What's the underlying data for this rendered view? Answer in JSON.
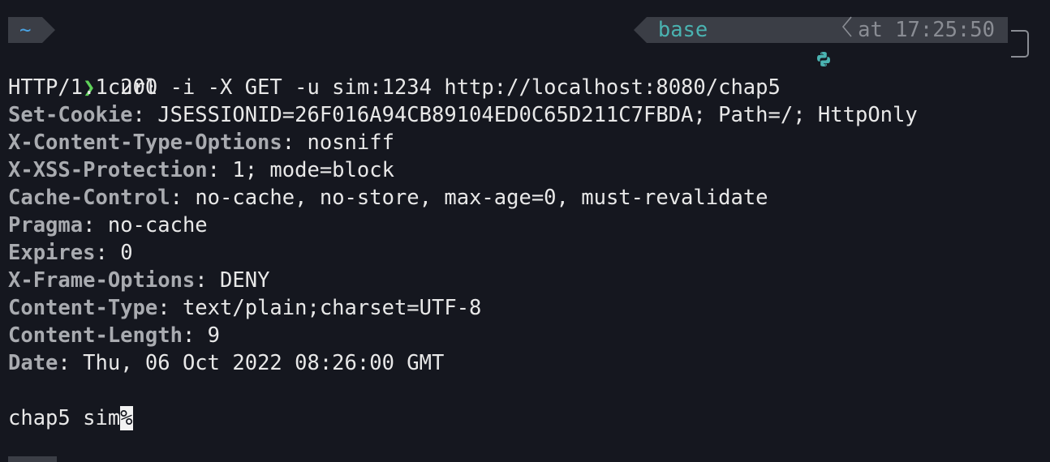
{
  "prompt": {
    "cwd": "~",
    "env_name": "base",
    "env_icon": "python-icon",
    "at_label": "at",
    "time": "17:25:50",
    "prompt_symbol": "❯"
  },
  "command": "curl -i -X GET -u sim:1234 http://localhost:8080/chap5",
  "status_line": "HTTP/1.1 200",
  "headers": [
    {
      "key": "Set-Cookie",
      "value": "JSESSIONID=26F016A94CB89104ED0C65D211C7FBDA; Path=/; HttpOnly"
    },
    {
      "key": "X-Content-Type-Options",
      "value": "nosniff"
    },
    {
      "key": "X-XSS-Protection",
      "value": "1; mode=block"
    },
    {
      "key": "Cache-Control",
      "value": "no-cache, no-store, max-age=0, must-revalidate"
    },
    {
      "key": "Pragma",
      "value": "no-cache"
    },
    {
      "key": "Expires",
      "value": "0"
    },
    {
      "key": "X-Frame-Options",
      "value": "DENY"
    },
    {
      "key": "Content-Type",
      "value": "text/plain;charset=UTF-8"
    },
    {
      "key": "Content-Length",
      "value": "9"
    },
    {
      "key": "Date",
      "value": "Thu, 06 Oct 2022 08:26:00 GMT"
    }
  ],
  "body": "chap5 sim",
  "eol_marker": "%",
  "colors": {
    "background": "#15171f",
    "prompt_segment": "#3b3e46",
    "cwd": "#4aa3e3",
    "env": "#4ab3b1",
    "prompt_symbol": "#5fd35a",
    "header_key": "#a9abb0"
  }
}
